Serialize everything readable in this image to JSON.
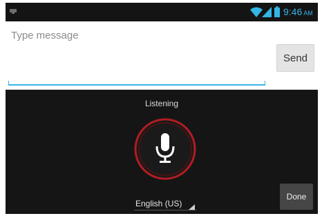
{
  "status_bar": {
    "time": "9:46",
    "ampm": "AM",
    "icons": [
      "notification-icon",
      "wifi-icon",
      "signal-icon",
      "battery-icon"
    ]
  },
  "compose": {
    "placeholder": "Type message",
    "send_label": "Send"
  },
  "voice": {
    "status_text": "Listening",
    "mic_icon": "microphone-icon",
    "language": "English (US)",
    "done_label": "Done"
  },
  "colors": {
    "accent": "#33b5e5",
    "mic_ring": "#b11d22",
    "panel_bg": "#151515"
  }
}
